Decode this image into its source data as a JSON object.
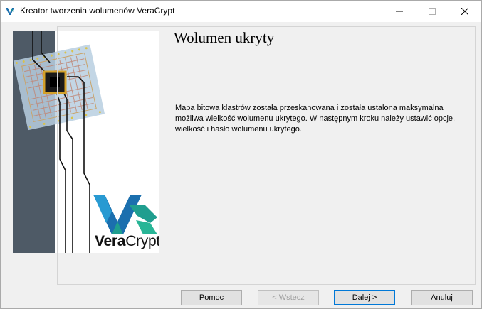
{
  "window": {
    "title": "Kreator tworzenia wolumenów VeraCrypt"
  },
  "banner": {
    "brand_bold": "Vera",
    "brand_regular": "Crypt"
  },
  "page": {
    "title": "Wolumen ukryty",
    "info": "Mapa bitowa klastrów została przeskanowana i została ustalona maksymalna możliwa wielkość wolumenu ukrytego. W następnym kroku należy ustawić opcje, wielkość i hasło wolumenu ukrytego."
  },
  "buttons": {
    "help": "Pomoc",
    "back": "< Wstecz",
    "next": "Dalej >",
    "cancel": "Anuluj"
  },
  "colors": {
    "accent": "#0078d7",
    "logo_teal": "#1f9e8f",
    "logo_blue": "#1b6fae",
    "stripe": "#4e5a66"
  }
}
